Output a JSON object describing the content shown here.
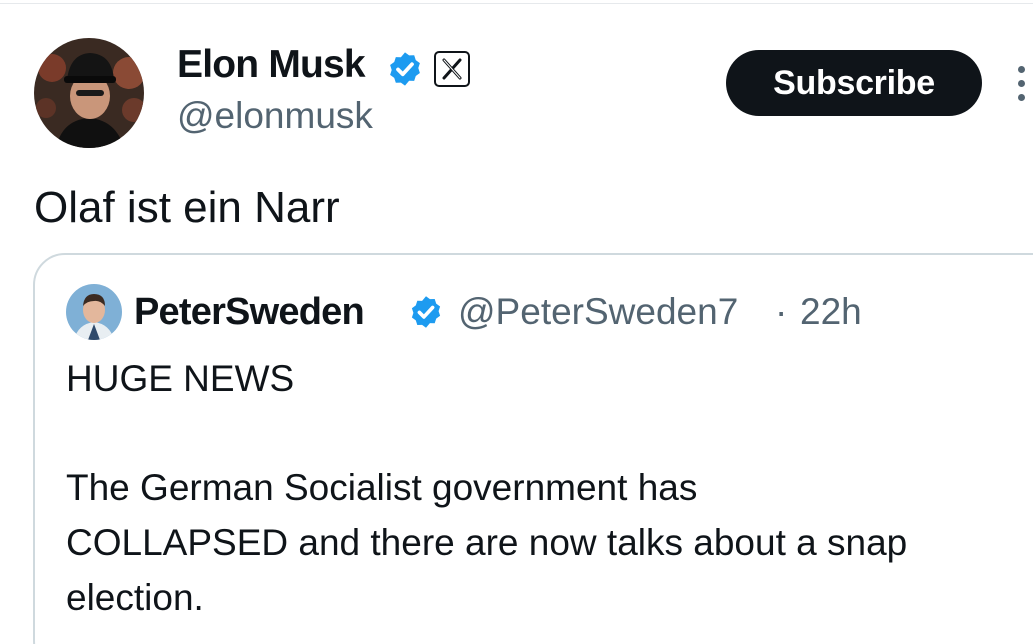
{
  "colors": {
    "text_primary": "#0f1419",
    "text_secondary": "#536471",
    "verified_blue": "#1d9bf0",
    "border": "#cfd9de",
    "button_bg": "#0f1419"
  },
  "icons": {
    "verified": "verified-badge-icon",
    "affiliation": "x-logo-icon",
    "more": "vertical-ellipsis-icon"
  },
  "tweet": {
    "author": {
      "name": "Elon Musk",
      "handle": "@elonmusk"
    },
    "subscribe_label": "Subscribe",
    "text": "Olaf ist ein Narr"
  },
  "quoted_tweet": {
    "author": {
      "name": "PeterSweden",
      "handle": "@PeterSweden7"
    },
    "separator": "·",
    "time": "22h",
    "lines": [
      "HUGE NEWS",
      "The German Socialist government has",
      "COLLAPSED and there are now talks about a snap",
      "election."
    ]
  }
}
